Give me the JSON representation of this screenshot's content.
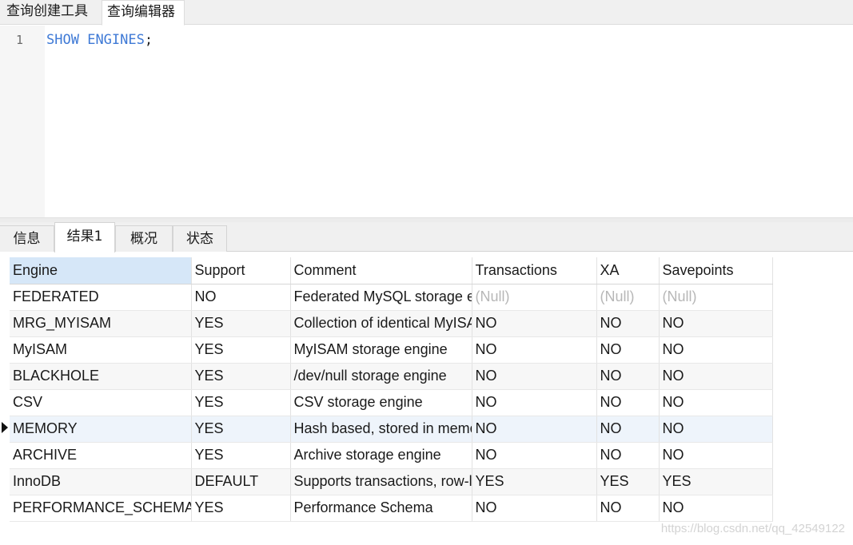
{
  "top_tabs": [
    {
      "label": "查询创建工具"
    },
    {
      "label": "查询编辑器"
    }
  ],
  "editor": {
    "line_number": "1",
    "code_kw1": "SHOW",
    "code_kw2": "ENGINES",
    "code_punct": ";"
  },
  "bottom_tabs": [
    {
      "label": "信息"
    },
    {
      "label": "结果1"
    },
    {
      "label": "概况"
    },
    {
      "label": "状态"
    }
  ],
  "results": {
    "columns": [
      "Engine",
      "Support",
      "Comment",
      "Transactions",
      "XA",
      "Savepoints"
    ],
    "rows": [
      [
        "FEDERATED",
        "NO",
        "Federated MySQL storage engine",
        "(Null)",
        "(Null)",
        "(Null)"
      ],
      [
        "MRG_MYISAM",
        "YES",
        "Collection of identical MyISAM tables",
        "NO",
        "NO",
        "NO"
      ],
      [
        "MyISAM",
        "YES",
        "MyISAM storage engine",
        "NO",
        "NO",
        "NO"
      ],
      [
        "BLACKHOLE",
        "YES",
        "/dev/null storage engine",
        "NO",
        "NO",
        "NO"
      ],
      [
        "CSV",
        "YES",
        "CSV storage engine",
        "NO",
        "NO",
        "NO"
      ],
      [
        "MEMORY",
        "YES",
        "Hash based, stored in memory",
        "NO",
        "NO",
        "NO"
      ],
      [
        "ARCHIVE",
        "YES",
        "Archive storage engine",
        "NO",
        "NO",
        "NO"
      ],
      [
        "InnoDB",
        "DEFAULT",
        "Supports transactions, row-level locking",
        "YES",
        "YES",
        "YES"
      ],
      [
        "PERFORMANCE_SCHEMA",
        "YES",
        "Performance Schema",
        "NO",
        "NO",
        "NO"
      ]
    ]
  },
  "watermark": "https://blog.csdn.net/qq_42549122",
  "colors": {
    "keyword": "#3f7ad6",
    "null_text": "#b7b7b7",
    "selected_header": "#d6e7f8"
  }
}
